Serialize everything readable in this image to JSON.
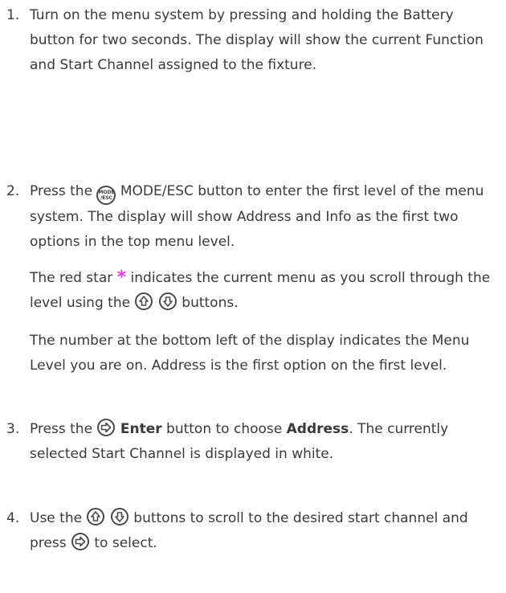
{
  "steps": [
    {
      "number": "1.",
      "text": "Turn on the menu system by pressing and holding the Battery button for two seconds. The display will show the current Function and Start Channel assigned to the fixture."
    },
    {
      "number": "2.",
      "mode_icon_top": "MODE",
      "mode_icon_bottom": "/ESC",
      "text_after_icon": " MODE/ESC button to enter the first level of the menu system. The display will show Address and Info as the first two options in the top menu level.",
      "text_before_icon": "Press the ",
      "para2_a": "The red star ",
      "para2_star": "*",
      "para2_b": " indicates the current menu as you scroll through the level using the ",
      "para2_c": " buttons.",
      "para3": "The number at the bottom left of the display indicates the Menu Level you are on. Address is the first option on the first level."
    },
    {
      "number": "3.",
      "text_a": "Press the ",
      "bold_enter": "Enter",
      "text_b": " button to choose ",
      "bold_address": "Address",
      "text_c": ". The currently selected Start Channel is displayed in white."
    },
    {
      "number": "4.",
      "text_a": "Use the ",
      "text_b": " buttons to scroll to the desired start channel and press ",
      "text_c": " to select."
    }
  ],
  "icons": {
    "up": "up-arrow-icon",
    "down": "down-arrow-icon",
    "enter": "enter-arrow-icon",
    "mode": "mode-esc-icon"
  },
  "colors": {
    "star": "#e83ee0",
    "text": "#3a3a3a"
  }
}
